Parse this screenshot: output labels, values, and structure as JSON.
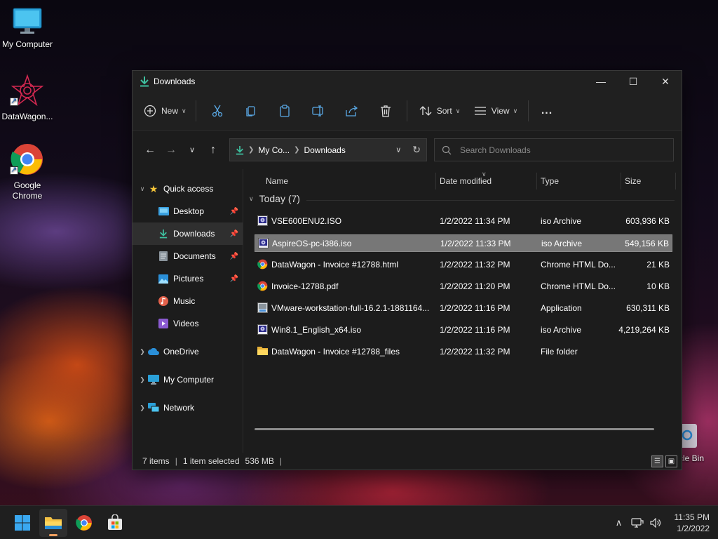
{
  "desktop": {
    "icons": [
      {
        "label": "My Computer"
      },
      {
        "label": "DataWagon..."
      },
      {
        "label": "Google Chrome"
      }
    ],
    "recycle_label": "cle Bin"
  },
  "window": {
    "title": "Downloads",
    "toolbar": {
      "new_label": "New",
      "sort_label": "Sort",
      "view_label": "View",
      "more_label": "..."
    },
    "address": {
      "crumbs": [
        "My Co...",
        "Downloads"
      ]
    },
    "search": {
      "placeholder": "Search Downloads"
    },
    "nav": {
      "quick_access": "Quick access",
      "items": [
        {
          "label": "Desktop"
        },
        {
          "label": "Downloads"
        },
        {
          "label": "Documents"
        },
        {
          "label": "Pictures"
        },
        {
          "label": "Music"
        },
        {
          "label": "Videos"
        }
      ],
      "onedrive": "OneDrive",
      "mycomputer": "My Computer",
      "network": "Network"
    },
    "columns": {
      "name": "Name",
      "date": "Date modified",
      "type": "Type",
      "size": "Size"
    },
    "group": "Today (7)",
    "files": [
      {
        "name": "VSE600ENU2.ISO",
        "date": "1/2/2022 11:34 PM",
        "type": "iso Archive",
        "size": "603,936 KB",
        "icon": "iso-icon"
      },
      {
        "name": "AspireOS-pc-i386.iso",
        "date": "1/2/2022 11:33 PM",
        "type": "iso Archive",
        "size": "549,156 KB",
        "icon": "iso-icon"
      },
      {
        "name": "DataWagon - Invoice #12788.html",
        "date": "1/2/2022 11:32 PM",
        "type": "Chrome HTML Do...",
        "size": "21 KB",
        "icon": "chrome-icon"
      },
      {
        "name": "Invoice-12788.pdf",
        "date": "1/2/2022 11:20 PM",
        "type": "Chrome HTML Do...",
        "size": "10 KB",
        "icon": "chrome-icon"
      },
      {
        "name": "VMware-workstation-full-16.2.1-1881164...",
        "date": "1/2/2022 11:16 PM",
        "type": "Application",
        "size": "630,311 KB",
        "icon": "installer-icon"
      },
      {
        "name": "Win8.1_English_x64.iso",
        "date": "1/2/2022 11:16 PM",
        "type": "iso Archive",
        "size": "4,219,264 KB",
        "icon": "iso-icon"
      },
      {
        "name": "DataWagon - Invoice #12788_files",
        "date": "1/2/2022 11:32 PM",
        "type": "File folder",
        "size": "",
        "icon": "folder-icon"
      }
    ],
    "status": {
      "count": "7 items",
      "selected": "1 item selected",
      "size": "536 MB"
    }
  },
  "taskbar": {
    "time": "11:35 PM",
    "date": "1/2/2022"
  }
}
